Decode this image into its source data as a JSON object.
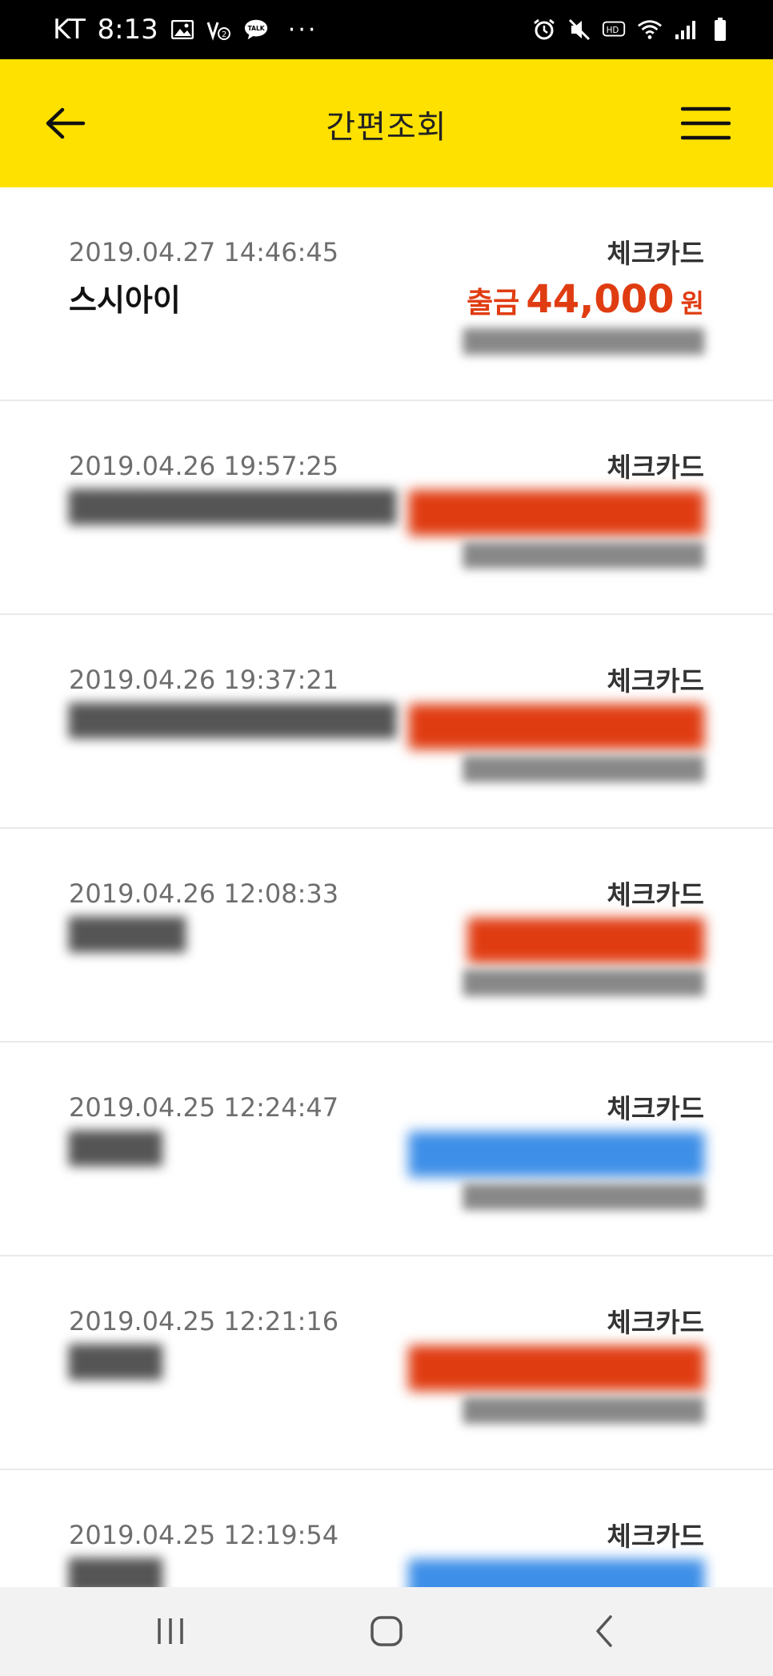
{
  "status_bar": {
    "carrier": "KT",
    "time": "8:13",
    "left_icons": [
      "gallery-icon",
      "vowifi-icon",
      "kakaotalk-icon"
    ],
    "more": "···",
    "right_icons": [
      "alarm-icon",
      "mute-icon",
      "hd-icon",
      "wifi-icon",
      "signal-icon",
      "battery-icon"
    ]
  },
  "header": {
    "title": "간편조회",
    "background_color": "#ffe100"
  },
  "colors": {
    "withdrawal": "#e03c12",
    "deposit": "#3e8fe8"
  },
  "transactions": [
    {
      "date": "2019.04.27 14:46:45",
      "merchant": "스시아이",
      "card_type": "체크카드",
      "kind": "출금",
      "amount": "44,000",
      "unit": "원",
      "balance": "",
      "blurred": false,
      "direction": "withdrawal"
    },
    {
      "date": "2019.04.26 19:57:25",
      "merchant": "",
      "card_type": "체크카드",
      "kind": "",
      "amount": "",
      "unit": "",
      "balance": "",
      "blurred": true,
      "direction": "withdrawal"
    },
    {
      "date": "2019.04.26 19:37:21",
      "merchant": "",
      "card_type": "체크카드",
      "kind": "",
      "amount": "",
      "unit": "",
      "balance": "",
      "blurred": true,
      "direction": "withdrawal"
    },
    {
      "date": "2019.04.26 12:08:33",
      "merchant": "",
      "card_type": "체크카드",
      "kind": "",
      "amount": "",
      "unit": "",
      "balance": "",
      "blurred": true,
      "direction": "withdrawal"
    },
    {
      "date": "2019.04.25 12:24:47",
      "merchant": "",
      "card_type": "체크카드",
      "kind": "",
      "amount": "",
      "unit": "",
      "balance": "",
      "blurred": true,
      "direction": "deposit"
    },
    {
      "date": "2019.04.25 12:21:16",
      "merchant": "",
      "card_type": "체크카드",
      "kind": "",
      "amount": "",
      "unit": "",
      "balance": "",
      "blurred": true,
      "direction": "withdrawal"
    },
    {
      "date": "2019.04.25 12:19:54",
      "merchant": "",
      "card_type": "체크카드",
      "kind": "",
      "amount": "",
      "unit": "",
      "balance": "",
      "blurred": true,
      "direction": "deposit"
    }
  ],
  "nav_bar": {
    "buttons": [
      "recent-apps-icon",
      "home-icon",
      "back-icon"
    ]
  }
}
